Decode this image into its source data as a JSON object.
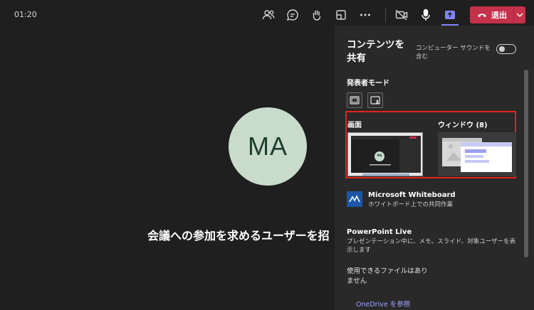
{
  "meeting": {
    "timer": "01:20",
    "leave_label": "退出",
    "avatar_initials": "MA",
    "waiting_message": "会議への参加を求めるユーザーを招"
  },
  "share_panel": {
    "title": "コンテンツを共有",
    "computer_sound_label": "コンピューター サウンドを含む",
    "computer_sound_on": false,
    "presenter_mode_label": "発表者モード",
    "screen_label": "画面",
    "window_label": "ウィンドウ (8)",
    "thumbnail_initials": "MA",
    "whiteboard_title": "Microsoft Whiteboard",
    "whiteboard_sub": "ホワイトボード上での共同作業",
    "powerpoint_title": "PowerPoint Live",
    "powerpoint_sub": "プレゼンテーション中に、メモ、スライド、対象ユーザーを表示します",
    "no_files": "使用できるファイルはありません",
    "onedrive_partial": "OneDrive を参照"
  },
  "colors": {
    "background": "#1f1f1f",
    "panel": "#292929",
    "accent": "#7f85f5",
    "leave": "#c4314b",
    "highlight": "#e0241c",
    "avatar": "#c9dccc"
  }
}
